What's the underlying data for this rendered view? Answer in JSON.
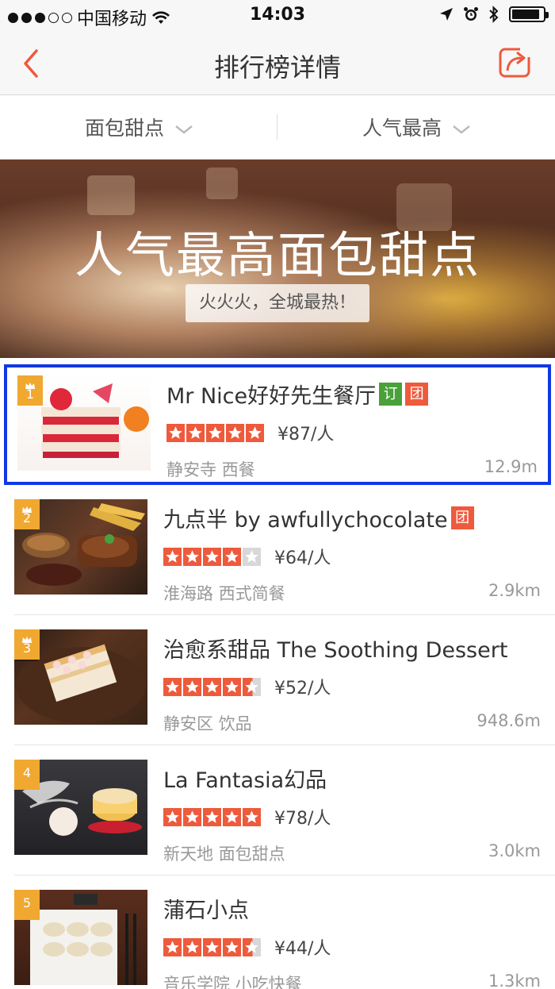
{
  "status": {
    "carrier": "中国移动",
    "time": "14:03"
  },
  "nav": {
    "title": "排行榜详情"
  },
  "filters": [
    {
      "label": "面包甜点"
    },
    {
      "label": "人气最高"
    }
  ],
  "banner": {
    "title": "人气最高面包甜点",
    "subtitle": "火火火，全城最热！"
  },
  "items": [
    {
      "rank": "1",
      "name": "Mr Nice好好先生餐厅",
      "tags": [
        "订",
        "团"
      ],
      "rating": 5,
      "price": "¥87/人",
      "area": "静安寺",
      "category": "西餐",
      "distance": "12.9m"
    },
    {
      "rank": "2",
      "name": "九点半 by awfullychocolate",
      "tags": [
        "团"
      ],
      "rating": 4,
      "price": "¥64/人",
      "area": "淮海路",
      "category": "西式简餐",
      "distance": "2.9km"
    },
    {
      "rank": "3",
      "name": "治愈系甜品 The Soothing Dessert",
      "tags": [],
      "rating": 4.5,
      "price": "¥52/人",
      "area": "静安区",
      "category": "饮品",
      "distance": "948.6m"
    },
    {
      "rank": "4",
      "name": "La Fantasia幻品",
      "tags": [],
      "rating": 5,
      "price": "¥78/人",
      "area": "新天地",
      "category": "面包甜点",
      "distance": "3.0km"
    },
    {
      "rank": "5",
      "name": "蒲石小点",
      "tags": [],
      "rating": 4.5,
      "price": "¥44/人",
      "area": "音乐学院",
      "category": "小吃快餐",
      "distance": "1.3km"
    }
  ],
  "colors": {
    "accent": "#ee5a3c",
    "highlight_border": "#1038e6",
    "rank_badge": "#f0a830",
    "tag_ding": "#4aa03a"
  }
}
